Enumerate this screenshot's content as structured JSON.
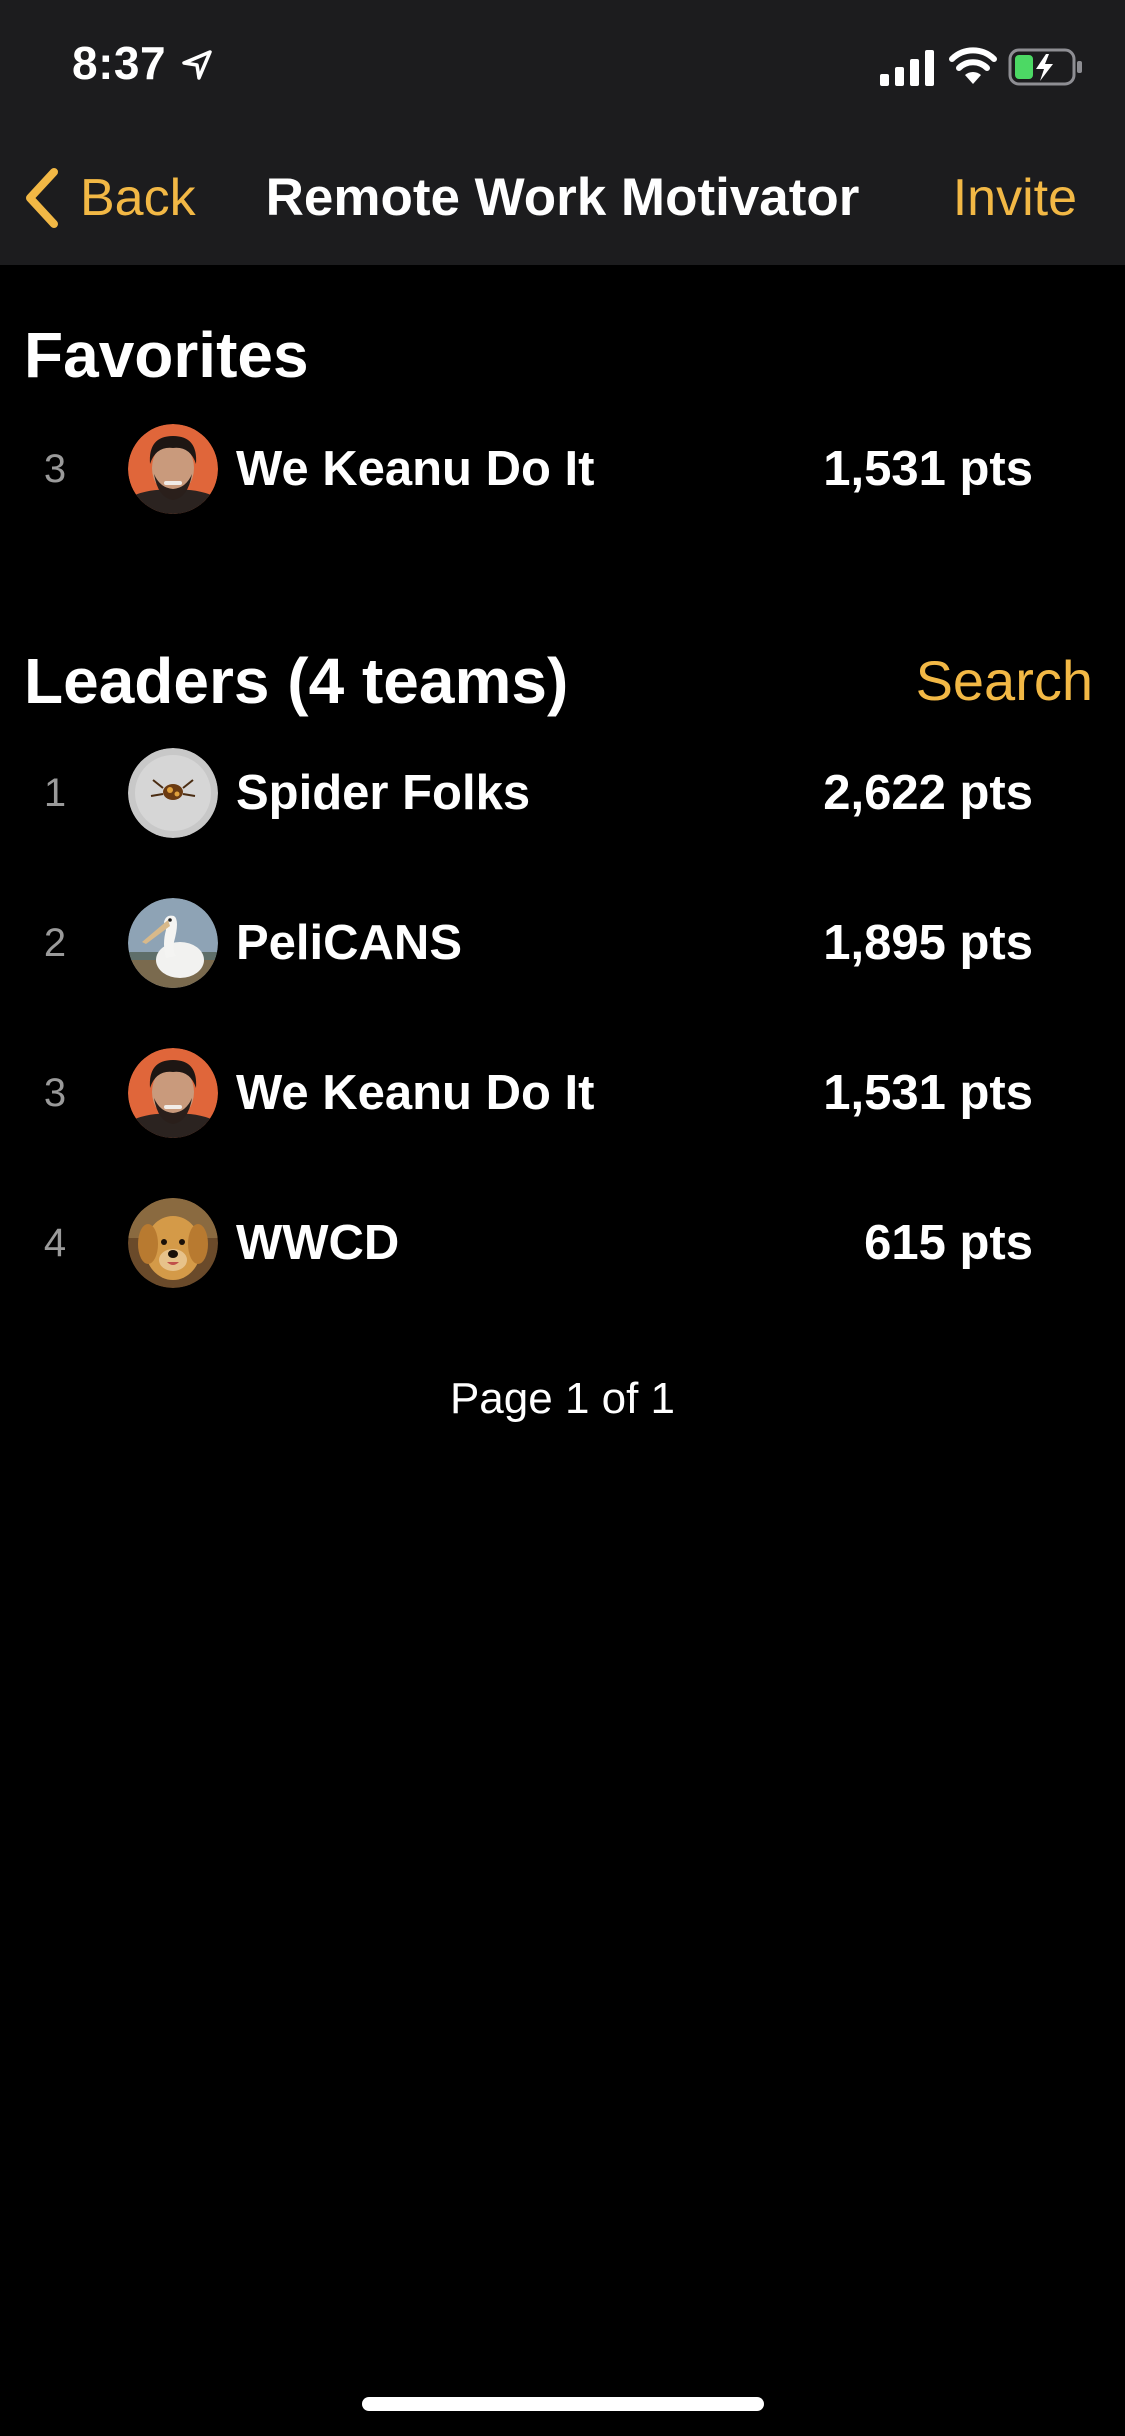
{
  "status_bar": {
    "time": "8:37",
    "icons": [
      "location-arrow-icon",
      "cellular-signal-icon",
      "wifi-icon",
      "battery-charging-icon"
    ]
  },
  "nav": {
    "back_label": "Back",
    "title": "Remote Work Motivator",
    "invite_label": "Invite"
  },
  "favorites": {
    "header": "Favorites",
    "items": [
      {
        "rank": "3",
        "name": "We Keanu Do It",
        "points": "1,531 pts",
        "avatar": "keanu-avatar"
      }
    ]
  },
  "leaders": {
    "header": "Leaders (4 teams)",
    "search_label": "Search",
    "items": [
      {
        "rank": "1",
        "name": "Spider Folks",
        "points": "2,622 pts",
        "avatar": "spider-avatar"
      },
      {
        "rank": "2",
        "name": "PeliCANS",
        "points": "1,895 pts",
        "avatar": "pelican-avatar"
      },
      {
        "rank": "3",
        "name": "We Keanu Do It",
        "points": "1,531 pts",
        "avatar": "keanu-avatar"
      },
      {
        "rank": "4",
        "name": "WWCD",
        "points": "615 pts",
        "avatar": "dog-avatar"
      }
    ]
  },
  "pagination": {
    "label": "Page 1 of 1"
  },
  "colors": {
    "accent": "#f2b845",
    "background": "#000000",
    "nav_background": "#1c1c1e",
    "rank_text": "#9a9a9a",
    "battery_fill": "#4cd964"
  }
}
